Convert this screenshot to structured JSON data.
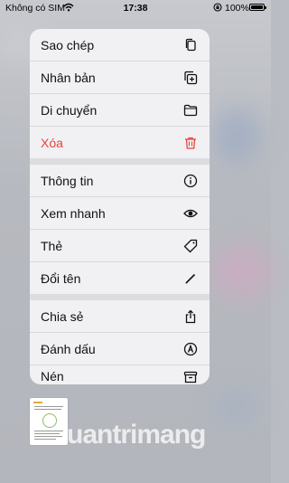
{
  "status": {
    "carrier": "Không có SIM",
    "time": "17:38",
    "battery": "100%",
    "battery_level": 1.0
  },
  "menu": {
    "groups": [
      [
        {
          "label": "Sao chép",
          "icon": "copy-icon"
        },
        {
          "label": "Nhân bản",
          "icon": "duplicate-icon"
        },
        {
          "label": "Di chuyển",
          "icon": "folder-icon"
        },
        {
          "label": "Xóa",
          "icon": "trash-icon",
          "color": "#e8443b"
        }
      ],
      [
        {
          "label": "Thông tin",
          "icon": "info-icon"
        },
        {
          "label": "Xem nhanh",
          "icon": "eye-icon"
        },
        {
          "label": "Thẻ",
          "icon": "tag-icon"
        },
        {
          "label": "Đổi tên",
          "icon": "pencil-icon"
        }
      ],
      [
        {
          "label": "Chia sẻ",
          "icon": "share-icon"
        },
        {
          "label": "Đánh dấu",
          "icon": "markup-icon"
        },
        {
          "label": "Nén",
          "icon": "archive-icon"
        }
      ]
    ]
  },
  "watermark": "uantrimang"
}
